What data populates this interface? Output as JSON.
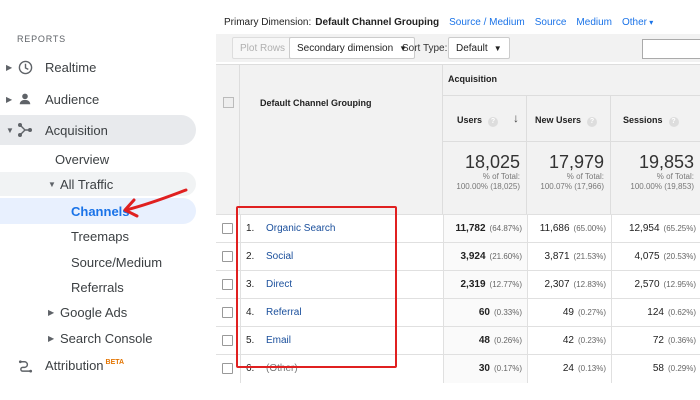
{
  "sidebar": {
    "section_label": "REPORTS",
    "items": [
      {
        "label": "Realtime",
        "icon": "clock-icon"
      },
      {
        "label": "Audience",
        "icon": "person-icon"
      },
      {
        "label": "Acquisition",
        "icon": "acquisition-icon"
      },
      {
        "label": "Attribution",
        "icon": "attribution-icon",
        "badge": "BETA"
      }
    ],
    "sub_items": {
      "overview": "Overview",
      "all_traffic": "All Traffic",
      "channels": "Channels",
      "treemaps": "Treemaps",
      "source_medium": "Source/Medium",
      "referrals": "Referrals",
      "google_ads": "Google Ads",
      "search_console": "Search Console"
    }
  },
  "dimension_bar": {
    "label": "Primary Dimension:",
    "selected": "Default Channel Grouping",
    "options": [
      "Source / Medium",
      "Source",
      "Medium"
    ],
    "other": "Other"
  },
  "toolbar": {
    "plot_rows": "Plot Rows",
    "secondary_dimension": "Secondary dimension",
    "sort_type_label": "Sort Type:",
    "sort_type_value": "Default"
  },
  "table": {
    "dimension_header": "Default Channel Grouping",
    "group_header": "Acquisition",
    "columns": [
      "Users",
      "New Users",
      "Sessions"
    ],
    "totals": [
      {
        "value": "18,025",
        "line1": "% of Total:",
        "line2": "100.00% (18,025)"
      },
      {
        "value": "17,979",
        "line1": "% of Total:",
        "line2": "100.07% (17,966)"
      },
      {
        "value": "19,853",
        "line1": "% of Total:",
        "line2": "100.00% (19,853)"
      }
    ],
    "rows": [
      {
        "rank": "1.",
        "name": "Organic Search",
        "users": "11,782",
        "users_pct": "(64.87%)",
        "new_users": "11,686",
        "new_users_pct": "(65.00%)",
        "sessions": "12,954",
        "sessions_pct": "(65.25%)"
      },
      {
        "rank": "2.",
        "name": "Social",
        "users": "3,924",
        "users_pct": "(21.60%)",
        "new_users": "3,871",
        "new_users_pct": "(21.53%)",
        "sessions": "4,075",
        "sessions_pct": "(20.53%)"
      },
      {
        "rank": "3.",
        "name": "Direct",
        "users": "2,319",
        "users_pct": "(12.77%)",
        "new_users": "2,307",
        "new_users_pct": "(12.83%)",
        "sessions": "2,570",
        "sessions_pct": "(12.95%)"
      },
      {
        "rank": "4.",
        "name": "Referral",
        "users": "60",
        "users_pct": "(0.33%)",
        "new_users": "49",
        "new_users_pct": "(0.27%)",
        "sessions": "124",
        "sessions_pct": "(0.62%)"
      },
      {
        "rank": "5.",
        "name": "Email",
        "users": "48",
        "users_pct": "(0.26%)",
        "new_users": "42",
        "new_users_pct": "(0.23%)",
        "sessions": "72",
        "sessions_pct": "(0.36%)"
      },
      {
        "rank": "6.",
        "name": "(Other)",
        "users": "30",
        "users_pct": "(0.17%)",
        "new_users": "24",
        "new_users_pct": "(0.13%)",
        "sessions": "58",
        "sessions_pct": "(0.29%)"
      }
    ]
  },
  "colors": {
    "accent": "#1a73e8",
    "annotation_red": "#e02020",
    "link_blue": "#1a4f9c"
  }
}
